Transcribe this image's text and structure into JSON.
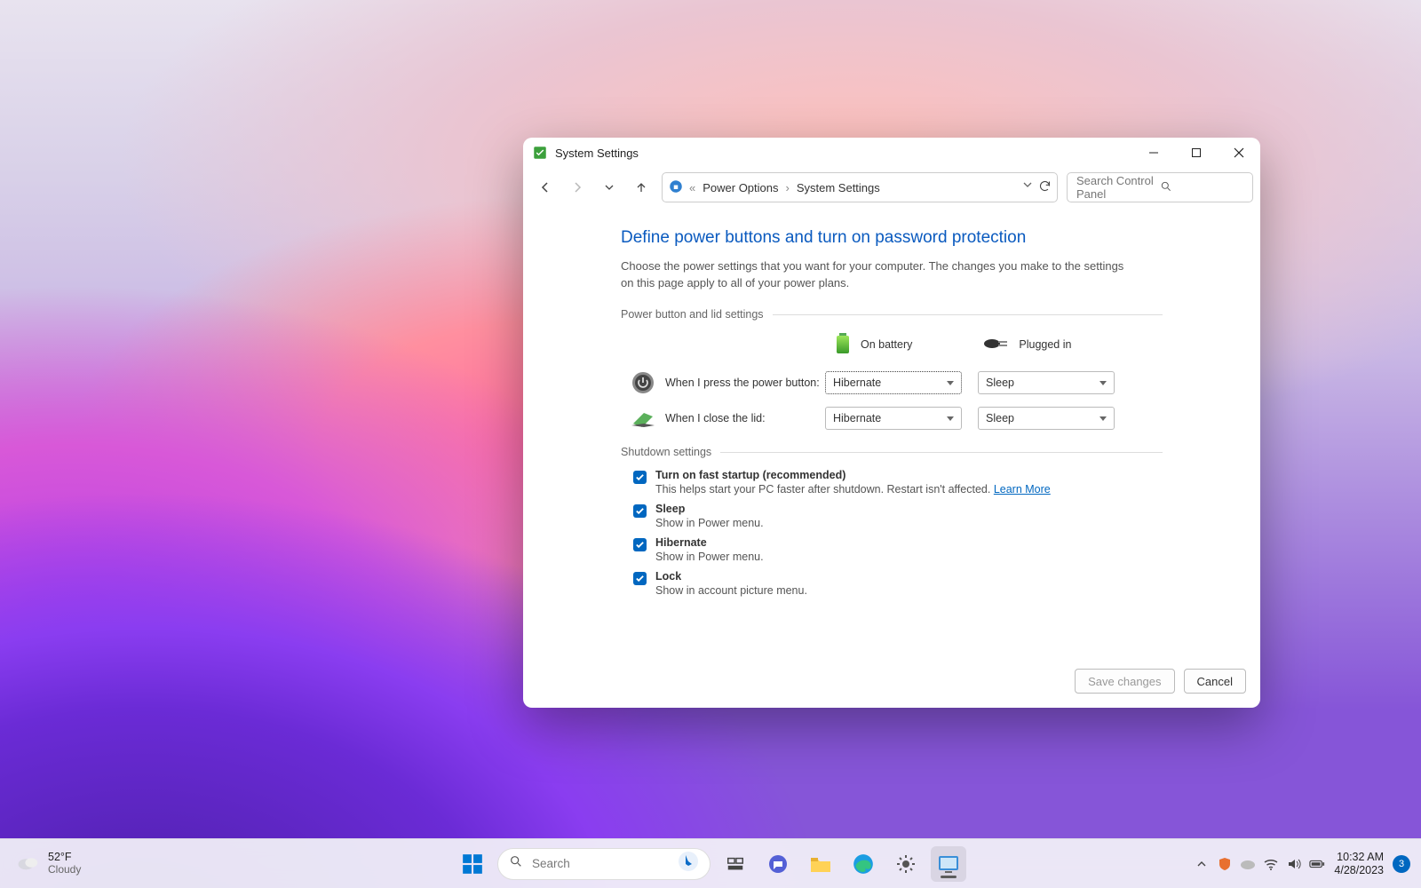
{
  "window": {
    "title": "System Settings",
    "breadcrumb_prefix": "«",
    "crumbs": [
      "Power Options",
      "System Settings"
    ]
  },
  "search": {
    "placeholder": "Search Control Panel"
  },
  "page": {
    "title": "Define power buttons and turn on password protection",
    "desc": "Choose the power settings that you want for your computer. The changes you make to the settings on this page apply to all of your power plans.",
    "section_power": "Power button and lid settings",
    "col_battery": "On battery",
    "col_plugged": "Plugged in",
    "row_power_button": "When I press the power button:",
    "row_lid": "When I close the lid:",
    "section_shutdown": "Shutdown settings",
    "dropdowns": {
      "power_battery": "Hibernate",
      "power_plugged": "Sleep",
      "lid_battery": "Hibernate",
      "lid_plugged": "Sleep"
    },
    "shutdown": [
      {
        "label": "Turn on fast startup (recommended)",
        "desc": "This helps start your PC faster after shutdown. Restart isn't affected.",
        "link": "Learn More"
      },
      {
        "label": "Sleep",
        "desc": "Show in Power menu."
      },
      {
        "label": "Hibernate",
        "desc": "Show in Power menu."
      },
      {
        "label": "Lock",
        "desc": "Show in account picture menu."
      }
    ],
    "save": "Save changes",
    "cancel": "Cancel"
  },
  "taskbar": {
    "temp": "52°F",
    "cond": "Cloudy",
    "search": "Search",
    "time": "10:32 AM",
    "date": "4/28/2023",
    "notif": "3"
  }
}
